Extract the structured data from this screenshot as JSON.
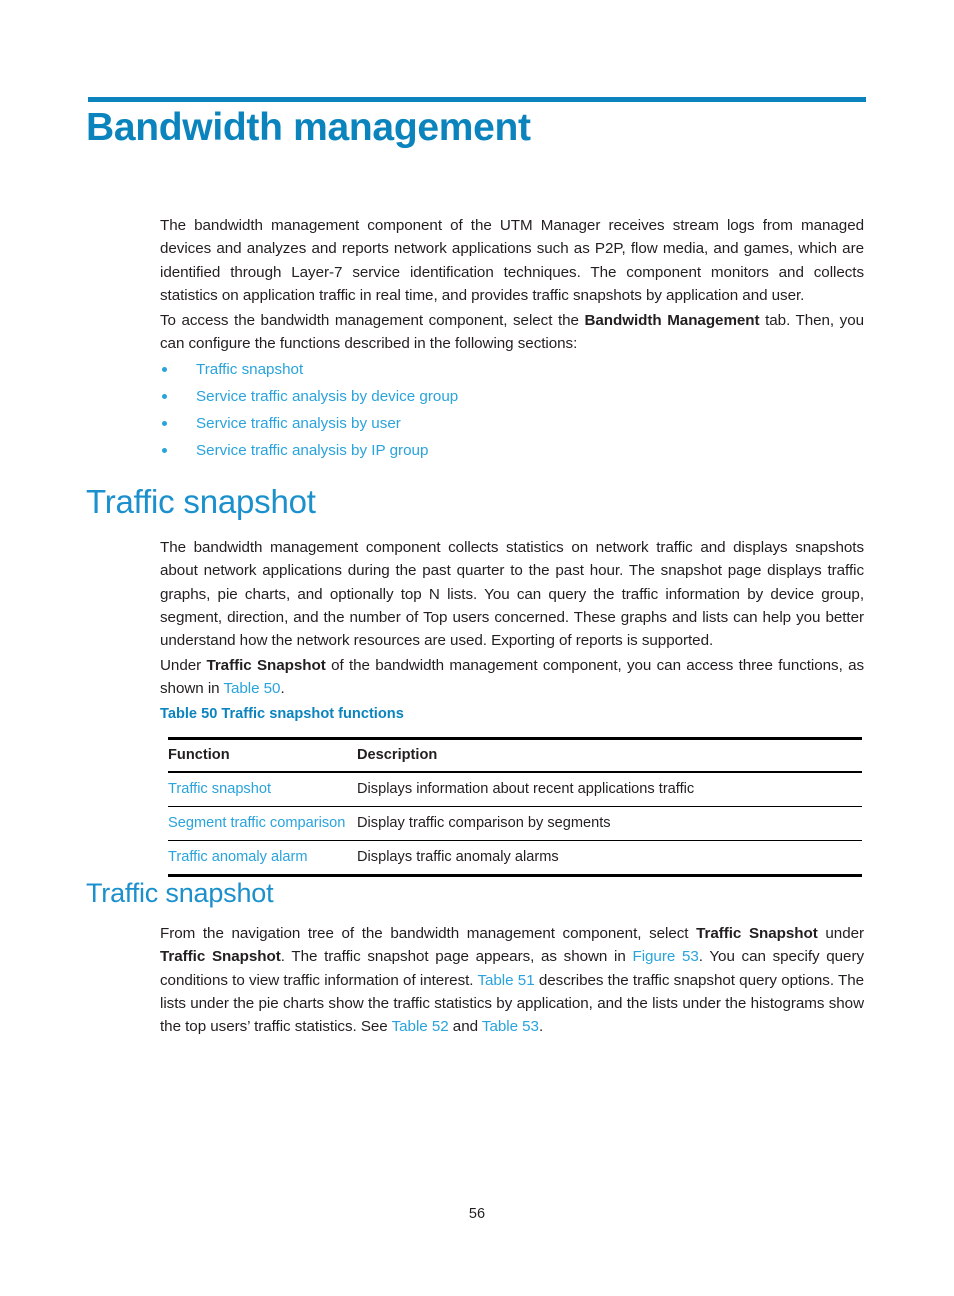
{
  "document": {
    "chapter_title": "Bandwidth management",
    "page_number": "56"
  },
  "intro": {
    "paragraph_1_part1": "The bandwidth management component of the UTM Manager receives stream logs from managed devices and analyzes and reports network applications such as P2P, flow media, and games, which are identified through Layer-7 service identification techniques. The component monitors and collects statistics on application traffic in real time, and provides traffic snapshots by application and user.",
    "paragraph_2_part1": "To access the bandwidth management component, select the ",
    "paragraph_2_bold": "Bandwidth Management",
    "paragraph_2_part2": " tab. Then, you can configure the functions described in the following sections:"
  },
  "bullets": [
    {
      "label": "Traffic snapshot"
    },
    {
      "label": "Service traffic analysis by device group"
    },
    {
      "label": "Service traffic analysis by user"
    },
    {
      "label": "Service traffic analysis by IP group"
    }
  ],
  "section_traffic_snapshot": {
    "heading": "Traffic snapshot",
    "paragraph_1": "The bandwidth management component collects statistics on network traffic and displays snapshots about network applications during the past quarter to the past hour. The snapshot page displays traffic graphs, pie charts, and optionally top N lists. You can query the traffic information by device group, segment, direction, and the number of Top users concerned. These graphs and lists can help you better understand how the network resources are used. Exporting of reports is supported.",
    "paragraph_2_part1": "Under ",
    "paragraph_2_bold": "Traffic Snapshot",
    "paragraph_2_part2": " of the bandwidth management component, you can access three functions, as shown in ",
    "paragraph_2_link": "Table 50",
    "paragraph_2_part3": "."
  },
  "table_50": {
    "caption": "Table 50 Traffic snapshot functions",
    "columns": [
      "Function",
      "Description"
    ],
    "rows": [
      {
        "function": "Traffic snapshot",
        "description": "Displays information about recent applications traffic"
      },
      {
        "function": "Segment traffic comparison",
        "description": "Display traffic comparison by segments"
      },
      {
        "function": "Traffic anomaly alarm",
        "description": "Displays traffic anomaly alarms"
      }
    ]
  },
  "subsection_traffic_snapshot": {
    "heading": "Traffic snapshot",
    "p_part1": "From the navigation tree of the bandwidth management component, select ",
    "p_bold1": "Traffic Snapshot",
    "p_part2": " under ",
    "p_bold2": "Traffic Snapshot",
    "p_part3": ". The traffic snapshot page appears, as shown in ",
    "p_link1": "Figure 53",
    "p_part4": ". You can specify query conditions to view traffic information of interest. ",
    "p_link2": "Table 51",
    "p_part5": " describes the traffic snapshot query options. The lists under the pie charts show the traffic statistics by application, and the lists under the histograms show the top users’ traffic statistics. See ",
    "p_link3": "Table 52",
    "p_part6": " and ",
    "p_link4": "Table 53",
    "p_part7": "."
  },
  "colors": {
    "title_blue": "#0b84be",
    "heading_blue": "#1b90cc",
    "link_blue": "#29a3dc",
    "body_black": "#231f20"
  }
}
